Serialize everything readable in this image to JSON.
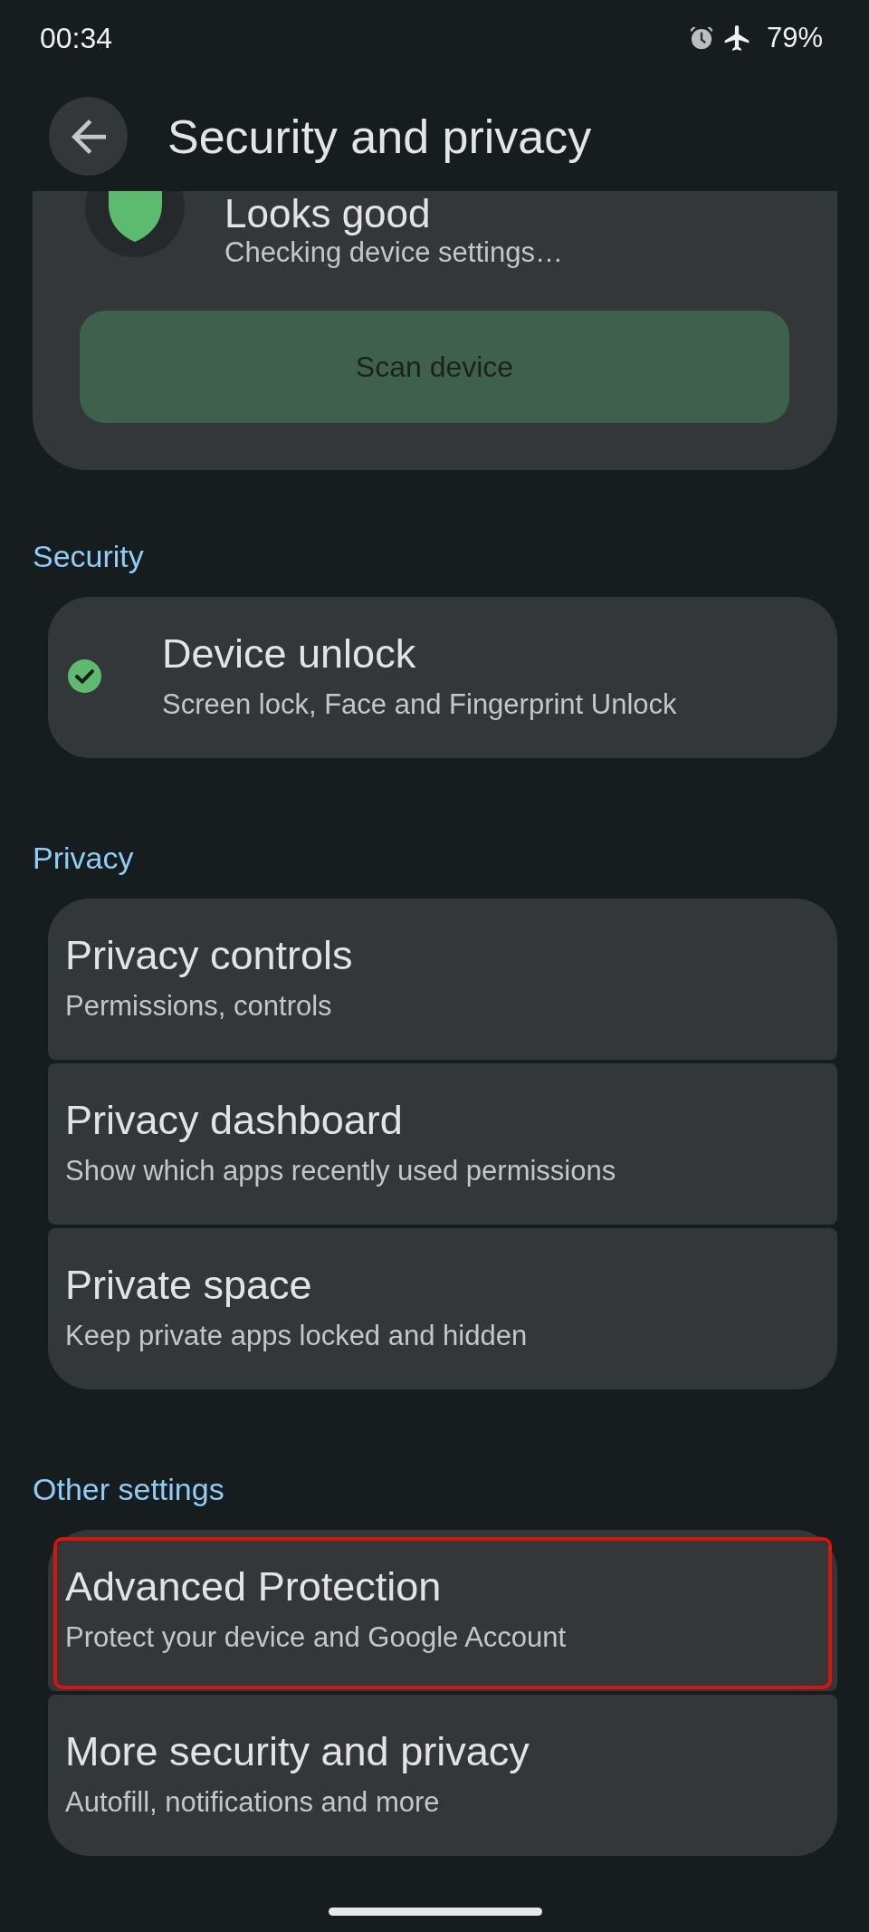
{
  "status_bar": {
    "time": "00:34",
    "battery": "79%"
  },
  "app_bar": {
    "title": "Security and privacy"
  },
  "status_card": {
    "title": "Looks good",
    "subtitle": "Checking device settings…",
    "button": "Scan device"
  },
  "sections": [
    {
      "header": "Security",
      "items": [
        {
          "kind": "status",
          "title": "Device unlock",
          "subtitle": "Screen lock, Face and Fingerprint Unlock",
          "highlighted": false
        }
      ]
    },
    {
      "header": "Privacy",
      "items": [
        {
          "kind": "plain",
          "title": "Privacy controls",
          "subtitle": "Permissions, controls",
          "highlighted": false
        },
        {
          "kind": "plain",
          "title": "Privacy dashboard",
          "subtitle": "Show which apps recently used permissions",
          "highlighted": false
        },
        {
          "kind": "plain",
          "title": "Private space",
          "subtitle": "Keep private apps locked and hidden",
          "highlighted": false
        }
      ]
    },
    {
      "header": "Other settings",
      "items": [
        {
          "kind": "plain",
          "title": "Advanced Protection",
          "subtitle": "Protect your device and Google Account",
          "highlighted": true
        },
        {
          "kind": "plain",
          "title": "More security and privacy",
          "subtitle": "Autofill, notifications and more",
          "highlighted": false
        }
      ]
    }
  ]
}
